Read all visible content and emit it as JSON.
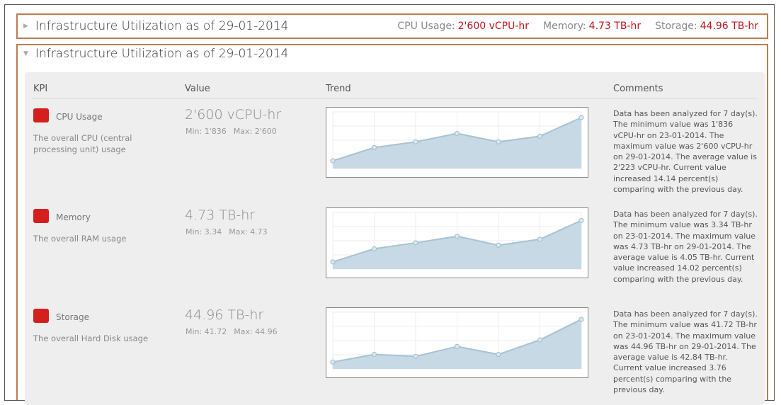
{
  "summary": {
    "title": "Infrastructure Utilization as of 29-01-2014",
    "metrics": [
      {
        "label": "CPU Usage:",
        "value": "2'600 vCPU-hr"
      },
      {
        "label": "Memory:",
        "value": "4.73 TB-hr"
      },
      {
        "label": "Storage:",
        "value": "44.96 TB-hr"
      }
    ]
  },
  "expanded": {
    "title": "Infrastructure Utilization as of 29-01-2014",
    "columns": {
      "kpi": "KPI",
      "value": "Value",
      "trend": "Trend",
      "comments": "Comments"
    },
    "rows": [
      {
        "name": "CPU Usage",
        "description": "The overall CPU (central processing unit) usage",
        "value": "2'600 vCPU-hr",
        "min": "Min: 1'836",
        "max": "Max: 2'600",
        "comment": "Data has been analyzed for 7 day(s). The minimum value was 1'836 vCPU-hr on 23-01-2014. The maximum value was 2'600 vCPU-hr on 29-01-2014. The average value is 2'223 vCPU-hr. Current value increased 14.14 percent(s) comparing with the previous day.",
        "trend": [
          1836,
          2070,
          2170,
          2320,
          2170,
          2270,
          2600
        ],
        "trend_range": [
          1700,
          2700
        ]
      },
      {
        "name": "Memory",
        "description": "The overall RAM usage",
        "value": "4.73 TB-hr",
        "min": "Min: 3.34",
        "max": "Max: 4.73",
        "comment": "Data has been analyzed for 7 day(s). The minimum value was 3.34 TB-hr on 23-01-2014. The maximum value was 4.73 TB-hr on 29-01-2014. The average value is 4.05 TB-hr. Current value increased 14.02 percent(s) comparing with the previous day.",
        "trend": [
          3.34,
          3.78,
          3.98,
          4.2,
          3.9,
          4.1,
          4.73
        ],
        "trend_range": [
          3.1,
          5.0
        ]
      },
      {
        "name": "Storage",
        "description": "The overall Hard Disk usage",
        "value": "44.96 TB-hr",
        "min": "Min: 41.72",
        "max": "Max: 44.96",
        "comment": "Data has been analyzed for 7 day(s). The minimum value was 41.72 TB-hr on 23-01-2014. The maximum value was 44.96 TB-hr on 29-01-2014. The average value is 42.84 TB-hr. Current value increased 3.76 percent(s) comparing with the previous day.",
        "trend": [
          41.72,
          42.3,
          42.15,
          42.9,
          42.3,
          43.4,
          44.96
        ],
        "trend_range": [
          41.2,
          45.5
        ]
      }
    ]
  },
  "colors": {
    "accent_red": "#c0141c",
    "badge_red": "#d51f1f",
    "frame_border": "#c07a4e",
    "trend_fill": "#c6d9e5",
    "trend_line": "#a7c2d3"
  }
}
